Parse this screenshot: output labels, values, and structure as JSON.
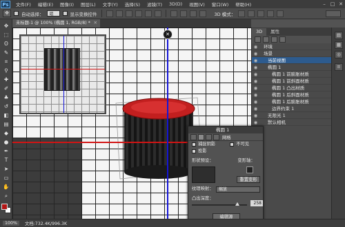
{
  "app": {
    "logo": "Ps"
  },
  "menu": [
    "文件(F)",
    "编辑(E)",
    "图像(I)",
    "图层(L)",
    "文字(Y)",
    "选择(S)",
    "滤镜(T)",
    "3D(D)",
    "视图(V)",
    "窗口(W)",
    "帮助(H)"
  ],
  "window_controls": [
    "–",
    "□",
    "✕"
  ],
  "options": {
    "auto_select_label": "自动选择：",
    "auto_select_value": "组",
    "show_transform_label": "显示变换控件",
    "mode_label": "3D 模式："
  },
  "document": {
    "tab_label": "未标题-1 @ 100% (椭圆 1, RGB/8) *",
    "close_glyph": "✕",
    "zoom": "100%",
    "doc_info": "文档:732.4K/996.3K"
  },
  "canvas": {
    "axis_knob": "✕"
  },
  "panel_3d": {
    "tabs": [
      "3D",
      "属性"
    ],
    "rows": [
      {
        "label": "环境",
        "indent": 1,
        "selected": false
      },
      {
        "label": "场景",
        "indent": 1,
        "selected": false
      },
      {
        "label": "当前视图",
        "indent": 2,
        "selected": true
      },
      {
        "label": "椭圆 1",
        "indent": 2,
        "selected": false
      },
      {
        "label": "椭圆 1 前膨胀材质",
        "indent": 3,
        "selected": false
      },
      {
        "label": "椭圆 1 前斜面材质",
        "indent": 3,
        "selected": false
      },
      {
        "label": "椭圆 1 凸出材质",
        "indent": 3,
        "selected": false
      },
      {
        "label": "椭圆 1 后斜面材质",
        "indent": 3,
        "selected": false
      },
      {
        "label": "椭圆 1 后膨胀材质",
        "indent": 3,
        "selected": false
      },
      {
        "label": "边界约束 1",
        "indent": 3,
        "selected": false
      },
      {
        "label": "无限光 1",
        "indent": 2,
        "selected": false
      },
      {
        "label": "默认相机",
        "indent": 2,
        "selected": false
      }
    ]
  },
  "properties": {
    "title": "椭圆 1",
    "tab_label": "网格",
    "catch_shadows": "捕捉阴影",
    "invisible": "不可见",
    "cast_shadows": "投影",
    "shape_preset": "形状预设：",
    "deform_axis": "变形轴：",
    "reset_deform": "重置变形",
    "texture_mapping_label": "纹理映射：",
    "texture_mapping_value": "缩放",
    "extrusion_depth_label": "凸出深度：",
    "extrusion_depth_value": "258",
    "extrusion_depth_fraction": 0.85,
    "edit_source": "编辑源"
  },
  "colors": {
    "accent": "#2d5b8e",
    "red_axis": "#d21414",
    "blue_axis": "#1414d8",
    "foreground": "#b31515",
    "background": "#ffffff"
  },
  "tools": [
    "move-icon",
    "marquee-icon",
    "lasso-icon",
    "quick-select-icon",
    "crop-icon",
    "eyedropper-icon",
    "healing-icon",
    "brush-icon",
    "stamp-icon",
    "history-brush-icon",
    "eraser-icon",
    "gradient-icon",
    "blur-icon",
    "dodge-icon",
    "pen-icon",
    "type-icon",
    "path-select-icon",
    "shape-icon",
    "hand-icon",
    "zoom-icon"
  ]
}
